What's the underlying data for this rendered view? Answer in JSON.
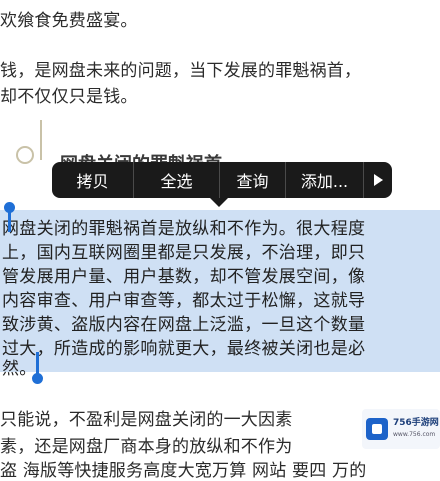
{
  "paragraphs": {
    "p1": "欢飨食免费盛宴。",
    "p2_line1": "钱，是网盘未来的问题，当下发展的罪魁祸首，",
    "p2_line2": "却不仅仅只是钱。",
    "heading": "网盘关闭的罪魁祸首"
  },
  "selection": {
    "lines": [
      "网盘关闭的罪魁祸首是放纵和不作为。很大程度",
      "上，国内互联网圈里都是只发展，不治理，即只",
      "管发展用户量、用户基数，却不管发展空间，像",
      "内容审查、用户审查等，都太过于松懈，这就导",
      "致涉黄、盗版内容在网盘上泛滥，一旦这个数量",
      "过大，所造成的影响就更大，最终被关闭也是必",
      "然。"
    ]
  },
  "after": {
    "line1": "只能说，不盈利是网盘关闭的一大因素",
    "line2": "素，还是网盘厂商本身的放纵和不作为",
    "line3": "盗 海版等快捷服务高度大宽万算    网站 要四 万的"
  },
  "context_menu": {
    "items": [
      "拷贝",
      "全选",
      "查询",
      "添加..."
    ],
    "more_icon": "play-icon"
  },
  "watermark": {
    "brand": "756手游网",
    "sub": "www.756.com"
  },
  "colors": {
    "selection": "#cfe0f4",
    "handle": "#1f6fd6",
    "menu_bg": "#1a1a1a"
  }
}
